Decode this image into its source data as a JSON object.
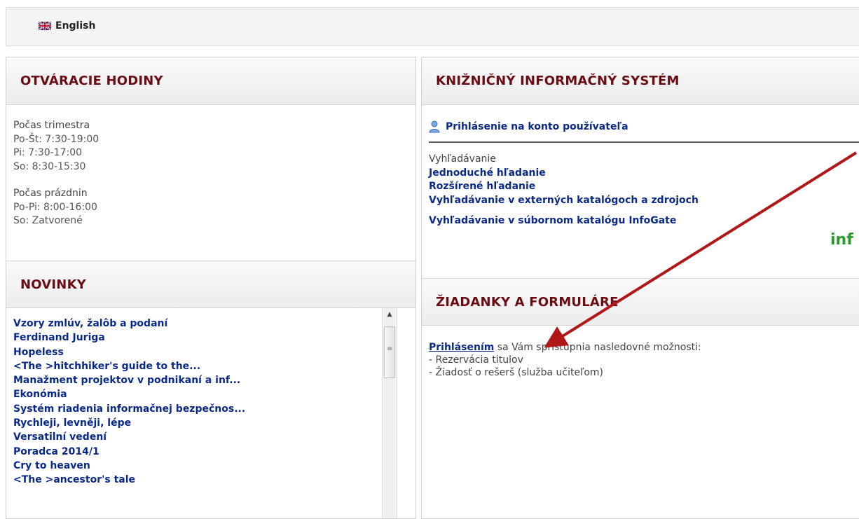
{
  "topbar": {
    "language_label": "English",
    "flag_icon": "uk-flag-icon"
  },
  "opening_hours": {
    "title": "OTVÁRACIE HODINY",
    "groups": [
      {
        "title": "Počas trimestra",
        "lines": [
          "Po-Št: 7:30-19:00",
          "Pi: 7:30-17:00",
          "So: 8:30-15:30"
        ]
      },
      {
        "title": "Počas prázdnin",
        "lines": [
          "Po-Pi: 8:00-16:00",
          "So: Zatvorené"
        ]
      }
    ]
  },
  "news": {
    "title": "NOVINKY",
    "items": [
      "Vzory zmlúv, žalôb a podaní",
      "Ferdinand Juriga",
      "Hopeless",
      "<The >hitchhiker's guide to the...",
      "Manažment projektov v podnikaní a inf...",
      "Ekonómia",
      "Systém riadenia informačnej bezpečnos...",
      "Rychleji, levněji, lépe",
      "Versatilní vedení",
      "Poradca 2014/1",
      "Cry to heaven",
      "<The >ancestor's tale"
    ]
  },
  "library_system": {
    "title": "KNIŽNIČNÝ INFORMAČNÝ SYSTÉM",
    "login_link": "Prihlásenie na konto používateľa",
    "search_label": "Vyhľadávanie",
    "links": [
      "Jednoduché hľadanie",
      "Rozšírené hľadanie",
      "Vyhľadávanie v externých katalógoch a zdrojoch"
    ],
    "infogate_link": "Vyhľadávanie v súbornom katalógu InfoGate",
    "logo_text": "inf"
  },
  "forms": {
    "title": "ŽIADANKY A FORMULÁRE",
    "login_link": "Prihlásením",
    "intro_rest": " sa Vám sprístupnia nasledovné možnosti:",
    "options": [
      "- Rezervácia titulov",
      "- Žiadosť o rešerš (služba učiteľom)"
    ]
  },
  "colors": {
    "header_text": "#6b0c14",
    "link": "#0a2a8a",
    "arrow": "#b01818",
    "logo": "#2a9a2a"
  }
}
